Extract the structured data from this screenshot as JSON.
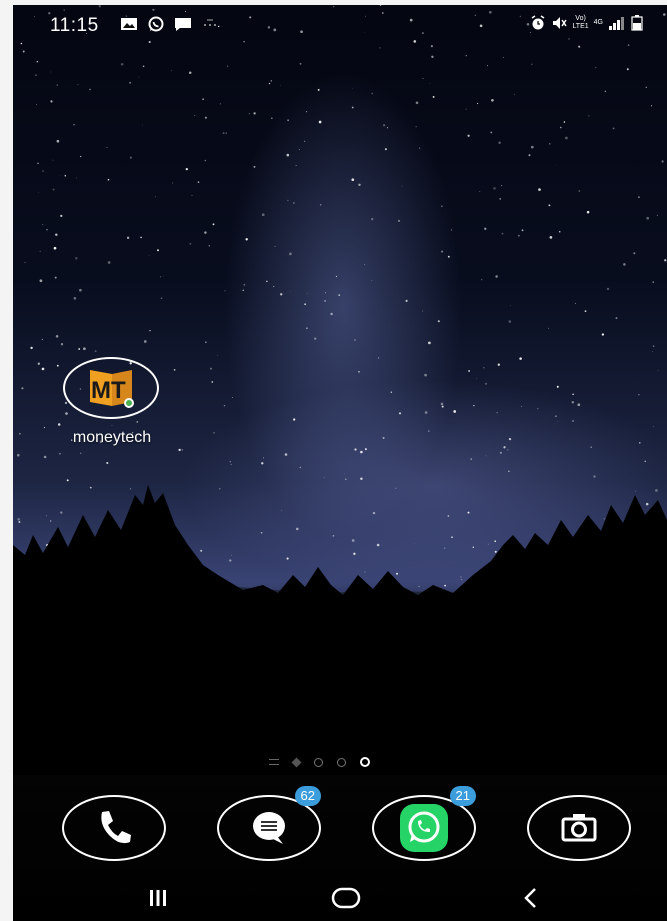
{
  "status_bar": {
    "time": "11:15",
    "left_icons": [
      "gallery-icon",
      "whatsapp-notification-icon",
      "message-notification-icon",
      "wifi-off-icon"
    ],
    "network_label_top": "Vo)",
    "network_label_bottom": "LTE1",
    "network_type": "4G",
    "right_icons": [
      "alarm-icon",
      "mute-icon",
      "signal-icon",
      "battery-icon"
    ]
  },
  "home_apps": [
    {
      "label": "moneytech",
      "icon": "moneytech-logo-icon",
      "logo_text": "MT"
    }
  ],
  "page_indicator": {
    "pages": 4,
    "active_page": 4
  },
  "dock": [
    {
      "name": "phone",
      "icon": "phone-icon",
      "badge": ""
    },
    {
      "name": "messages",
      "icon": "chat-bubble-icon",
      "badge": "62"
    },
    {
      "name": "whatsapp",
      "icon": "whatsapp-icon",
      "badge": "21"
    },
    {
      "name": "camera",
      "icon": "camera-icon",
      "badge": ""
    }
  ],
  "nav_bar": [
    "recents-icon",
    "home-icon",
    "back-icon"
  ],
  "colors": {
    "badge": "#3b9ddb",
    "whatsapp_green": "#25d366",
    "logo_orange": "#f0a020"
  }
}
